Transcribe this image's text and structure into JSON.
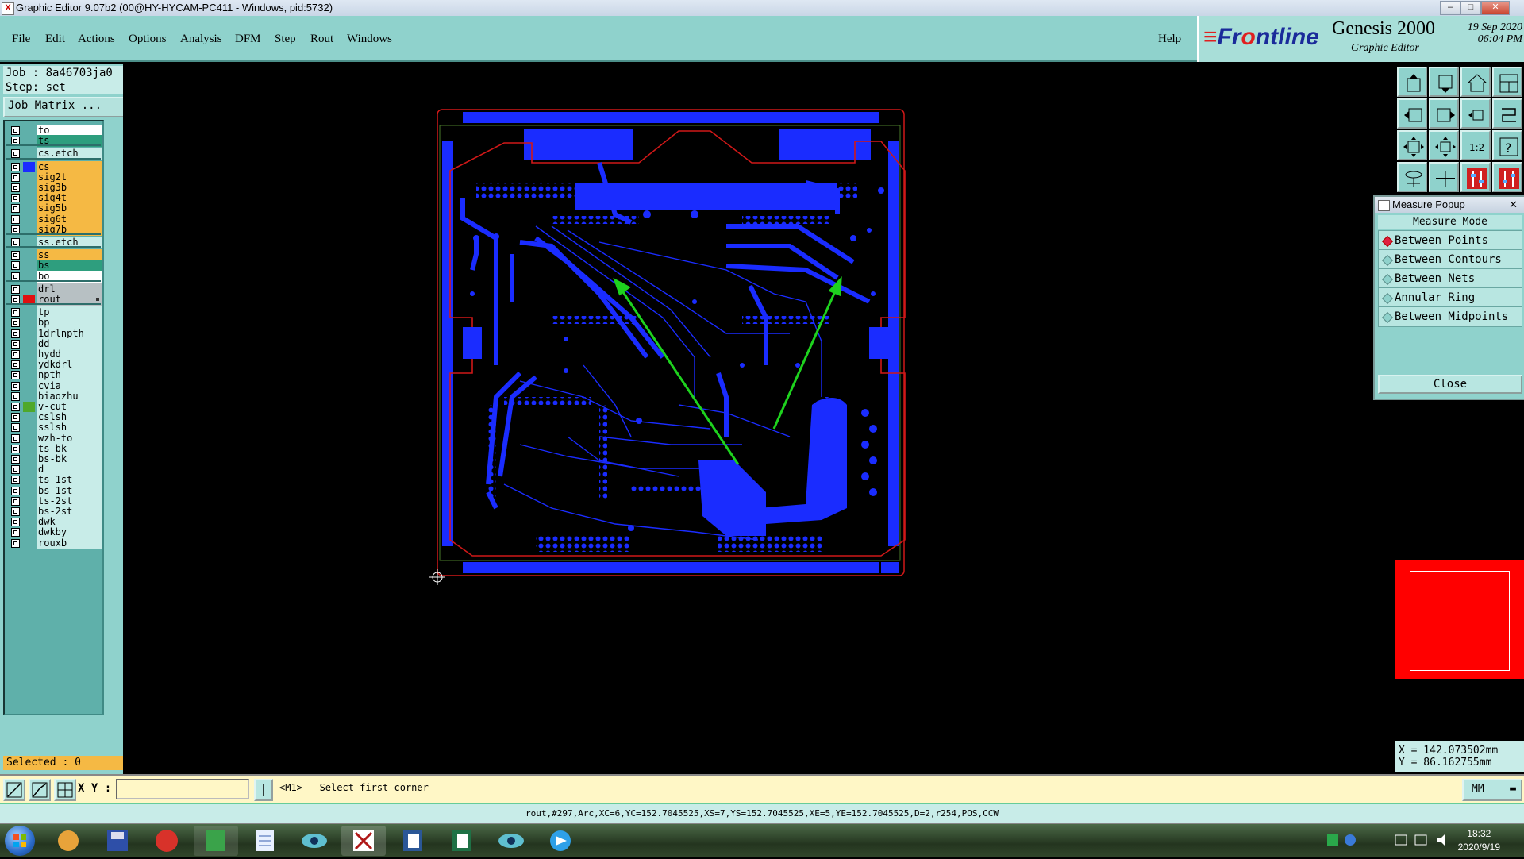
{
  "window": {
    "title": "Graphic Editor 9.07b2 (00@HY-HYCAM-PC411 - Windows, pid:5732)",
    "min_glyph": "–",
    "max_glyph": "□",
    "close_glyph": "✕"
  },
  "menu": [
    "File",
    "Edit",
    "Actions",
    "Options",
    "Analysis",
    "DFM",
    "Step",
    "Rout",
    "Windows"
  ],
  "help_label": "Help",
  "brand": {
    "logo_mark": "≡",
    "logo_front": "Fr",
    "logo_o": "o",
    "logo_rest": "ntline",
    "product": "Genesis 2000",
    "subtitle": "Graphic Editor",
    "date": "19 Sep 2020",
    "time": "06:04 PM"
  },
  "job": {
    "job_line": "Job : 8a46703ja0",
    "step_line": "Step: set",
    "matrix_button": "Job Matrix ..."
  },
  "layers": [
    {
      "name": "to",
      "bg": "#ffffff",
      "swatch": ""
    },
    {
      "name": "ts",
      "bg": "#2e9e7e",
      "swatch": ""
    },
    {
      "name": "cs.etch",
      "bg": "#c8ece8",
      "swatch": ""
    },
    {
      "name": "cs",
      "bg": "#f5b944",
      "swatch": "#1a2cff"
    },
    {
      "name": "sig2t",
      "bg": "#f5b944",
      "swatch": ""
    },
    {
      "name": "sig3b",
      "bg": "#f5b944",
      "swatch": ""
    },
    {
      "name": "sig4t",
      "bg": "#f5b944",
      "swatch": ""
    },
    {
      "name": "sig5b",
      "bg": "#f5b944",
      "swatch": ""
    },
    {
      "name": "sig6t",
      "bg": "#f5b944",
      "swatch": ""
    },
    {
      "name": "sig7b",
      "bg": "#f5b944",
      "swatch": ""
    },
    {
      "name": "ss.etch",
      "bg": "#c8ece8",
      "swatch": ""
    },
    {
      "name": "ss",
      "bg": "#f5b944",
      "swatch": ""
    },
    {
      "name": "bs",
      "bg": "#2e9e7e",
      "swatch": ""
    },
    {
      "name": "bo",
      "bg": "#ffffff",
      "swatch": ""
    },
    {
      "name": "drl",
      "bg": "#b7c0c3",
      "swatch": ""
    },
    {
      "name": "rout",
      "bg": "#b7c0c3",
      "swatch": "#e01010"
    },
    {
      "name": "tp",
      "bg": "#c8ece8",
      "swatch": ""
    },
    {
      "name": "bp",
      "bg": "#c8ece8",
      "swatch": ""
    },
    {
      "name": "1drlnpth",
      "bg": "#c8ece8",
      "swatch": ""
    },
    {
      "name": "dd",
      "bg": "#c8ece8",
      "swatch": ""
    },
    {
      "name": "hydd",
      "bg": "#c8ece8",
      "swatch": ""
    },
    {
      "name": "ydkdrl",
      "bg": "#c8ece8",
      "swatch": ""
    },
    {
      "name": "npth",
      "bg": "#c8ece8",
      "swatch": ""
    },
    {
      "name": "cvia",
      "bg": "#c8ece8",
      "swatch": ""
    },
    {
      "name": "biaozhu",
      "bg": "#c8ece8",
      "swatch": ""
    },
    {
      "name": "v-cut",
      "bg": "#c8ece8",
      "swatch": "#4fa82a"
    },
    {
      "name": "cslsh",
      "bg": "#c8ece8",
      "swatch": ""
    },
    {
      "name": "sslsh",
      "bg": "#c8ece8",
      "swatch": ""
    },
    {
      "name": "wzh-to",
      "bg": "#c8ece8",
      "swatch": ""
    },
    {
      "name": "ts-bk",
      "bg": "#c8ece8",
      "swatch": ""
    },
    {
      "name": "bs-bk",
      "bg": "#c8ece8",
      "swatch": ""
    },
    {
      "name": "d",
      "bg": "#c8ece8",
      "swatch": ""
    },
    {
      "name": "ts-1st",
      "bg": "#c8ece8",
      "swatch": ""
    },
    {
      "name": "bs-1st",
      "bg": "#c8ece8",
      "swatch": ""
    },
    {
      "name": "ts-2st",
      "bg": "#c8ece8",
      "swatch": ""
    },
    {
      "name": "bs-2st",
      "bg": "#c8ece8",
      "swatch": ""
    },
    {
      "name": "dwk",
      "bg": "#c8ece8",
      "swatch": ""
    },
    {
      "name": "dwkby",
      "bg": "#c8ece8",
      "swatch": ""
    },
    {
      "name": "rouxb",
      "bg": "#c8ece8",
      "swatch": ""
    }
  ],
  "selected_label": "Selected : 0",
  "measure": {
    "title": "Measure Popup",
    "close_x": "✕",
    "mode_label": "Measure Mode",
    "options": [
      {
        "label": "Between Points",
        "active": true
      },
      {
        "label": "Between Contours",
        "active": false
      },
      {
        "label": "Between Nets",
        "active": false
      },
      {
        "label": "Annular Ring",
        "active": false
      },
      {
        "label": "Between Midpoints",
        "active": false
      }
    ],
    "close_button": "Close"
  },
  "coords": {
    "x": "X = 142.073502mm",
    "y": "Y = 86.162755mm"
  },
  "command": {
    "xy_label": "X Y :",
    "xy_value": "",
    "prompt": "<M1> - Select first corner",
    "units": "MM"
  },
  "info_line": "rout,#297,Arc,XC=6,YC=152.7045525,XS=7,YS=152.7045525,XE=5,YE=152.7045525,D=2,r254,POS,CCW",
  "clock": {
    "time": "18:32",
    "date": "2020/9/19"
  },
  "tool_icons": [
    "pan-up-icon",
    "pan-down-icon",
    "home-icon",
    "window-icon",
    "pan-left-icon",
    "pan-right-icon",
    "zoom-center-icon",
    "redraw-icon",
    "fit-icon",
    "zoom-fit-icon",
    "scale-1-2-icon",
    "help-icon",
    "measure-icon",
    "ruler-icon",
    "snap-icon",
    "snap-alt-icon"
  ],
  "colors": {
    "panel": "#8fd2cc",
    "copper": "#1a2cff",
    "rout": "#d01818",
    "arrow": "#1ed21e"
  }
}
